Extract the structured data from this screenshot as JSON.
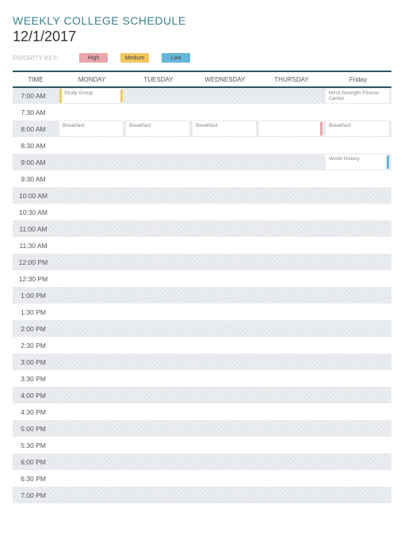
{
  "header": {
    "title": "WEEKLY COLLEGE SCHEDULE",
    "date": "12/1/2017"
  },
  "priority": {
    "label": "PRIORITY KEY:",
    "high": "High",
    "medium": "Medium",
    "low": "Low"
  },
  "columns": {
    "time": "TIME",
    "monday": "MONDAY",
    "tuesday": "TUESDAY",
    "wednesday": "WEDNESDAY",
    "thursday": "THURSDAY",
    "friday": "Friday"
  },
  "times": [
    "7:00 AM",
    "7:30 AM",
    "8:00 AM",
    "8:30 AM",
    "9:00 AM",
    "9:30 AM",
    "10:00 AM",
    "10:30 AM",
    "11:00 AM",
    "11:30 AM",
    "12:00 PM",
    "12:30 PM",
    "1:00 PM",
    "1:30 PM",
    "2:00 PM",
    "2:30 PM",
    "3:00 PM",
    "3:30 PM",
    "4:00 PM",
    "4:30 PM",
    "5:00 PM",
    "5:30 PM",
    "6:00 PM",
    "6:30 PM",
    "7:00 PM"
  ],
  "events": [
    {
      "row": 0,
      "col": "monday",
      "text": "Study Group",
      "priority": "medium",
      "rightbar": "medium"
    },
    {
      "row": 0,
      "col": "friday",
      "text": "Mind Strength Fitness Center",
      "priority": "none"
    },
    {
      "row": 2,
      "col": "monday",
      "text": "Breakfast",
      "priority": "none"
    },
    {
      "row": 2,
      "col": "tuesday",
      "text": "Breakfast",
      "priority": "none"
    },
    {
      "row": 2,
      "col": "wednesday",
      "text": "Breakfast",
      "priority": "none"
    },
    {
      "row": 2,
      "col": "thursday",
      "text": "",
      "priority": "none",
      "rightbar": "high"
    },
    {
      "row": 2,
      "col": "friday",
      "text": "Breakfast",
      "priority": "none"
    },
    {
      "row": 4,
      "col": "friday",
      "text": "World History",
      "priority": "none",
      "rightbar": "low"
    }
  ]
}
